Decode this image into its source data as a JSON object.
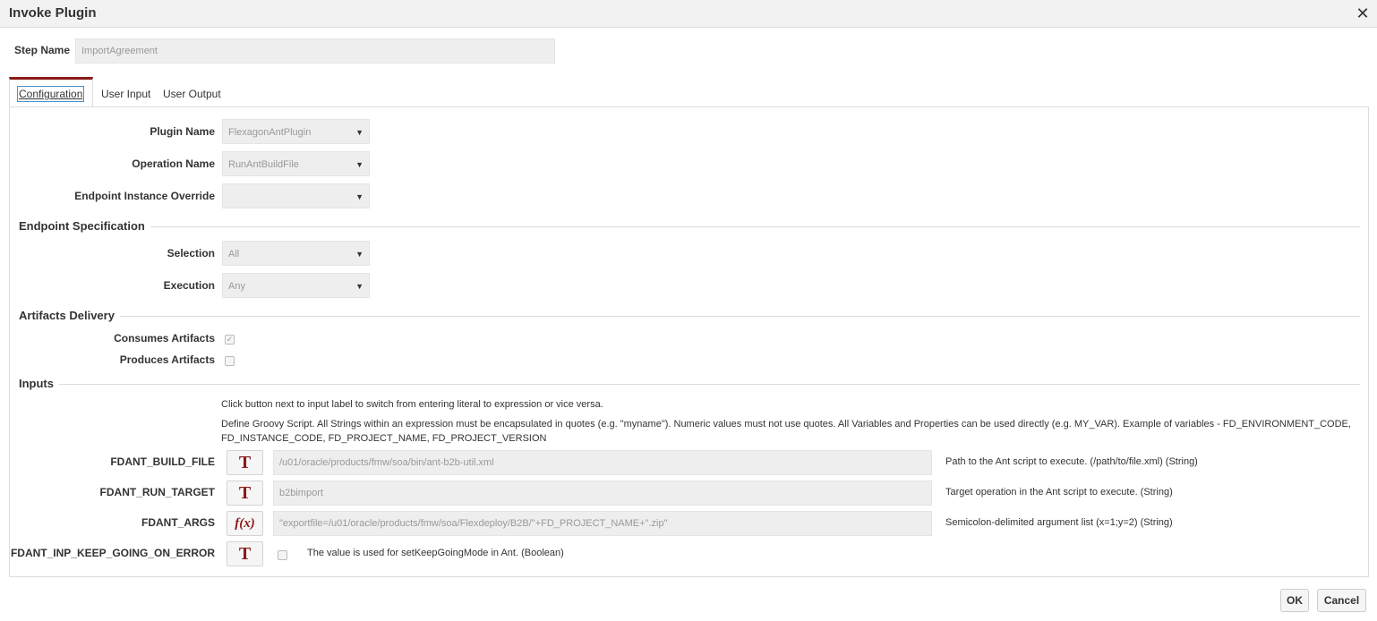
{
  "dialog": {
    "title": "Invoke Plugin",
    "close_icon": "close-icon",
    "close_glyph": "✕"
  },
  "step": {
    "label": "Step Name",
    "value": "ImportAgreement"
  },
  "tabs": [
    {
      "label": "Configuration",
      "active": true
    },
    {
      "label": "User Input",
      "active": false
    },
    {
      "label": "User Output",
      "active": false
    }
  ],
  "config": {
    "plugin_name": {
      "label": "Plugin Name",
      "value": "FlexagonAntPlugin"
    },
    "operation_name": {
      "label": "Operation Name",
      "value": "RunAntBuildFile"
    },
    "endpoint_override": {
      "label": "Endpoint Instance Override",
      "value": ""
    }
  },
  "endpoint_spec": {
    "title": "Endpoint Specification",
    "selection": {
      "label": "Selection",
      "value": "All"
    },
    "execution": {
      "label": "Execution",
      "value": "Any"
    }
  },
  "artifacts": {
    "title": "Artifacts Delivery",
    "consumes": {
      "label": "Consumes Artifacts",
      "checked": true,
      "check_glyph": "✓"
    },
    "produces": {
      "label": "Produces Artifacts",
      "checked": false
    }
  },
  "inputs": {
    "title": "Inputs",
    "help1": "Click button next to input label to switch from entering literal to expression or vice versa.",
    "help2a": "Define Groovy Script. All Strings within an expression must be encapsulated in quotes (e.g. \"myname\"). Numeric values must not use quotes. All Variables and Properties can be used directly (e.g. MY_VAR). Example of variables - FD_ENVIRONMENT_CODE,",
    "help2b": "FD_INSTANCE_CODE, FD_PROJECT_NAME, FD_PROJECT_VERSION",
    "rows": [
      {
        "label": "FDANT_BUILD_FILE",
        "mode": "T",
        "value": "/u01/oracle/products/fmw/soa/bin/ant-b2b-util.xml",
        "desc": "Path to the Ant script to execute. (/path/to/file.xml) (String)"
      },
      {
        "label": "FDANT_RUN_TARGET",
        "mode": "T",
        "value": "b2bimport",
        "desc": "Target operation in the Ant script to execute. (String)"
      },
      {
        "label": "FDANT_ARGS",
        "mode": "f(x)",
        "value": "\"exportfile=/u01/oracle/products/fmw/soa/Flexdeploy/B2B/\"+FD_PROJECT_NAME+\".zip\"",
        "desc": "Semicolon-delimited argument list (x=1;y=2) (String)"
      },
      {
        "label": "FDANT_INP_KEEP_GOING_ON_ERROR",
        "mode": "T",
        "checked": false,
        "desc": "The value is used for setKeepGoingMode in Ant. (Boolean)"
      }
    ]
  },
  "footer": {
    "ok_label": "OK",
    "cancel_label": "Cancel"
  },
  "colors": {
    "accent": "#8b1a1a",
    "tab_focus": "#4a90c8",
    "input_bg": "#eeeeee"
  },
  "icons": {
    "dropdown": "caret-down-icon",
    "dropdown_glyph": "▼"
  }
}
